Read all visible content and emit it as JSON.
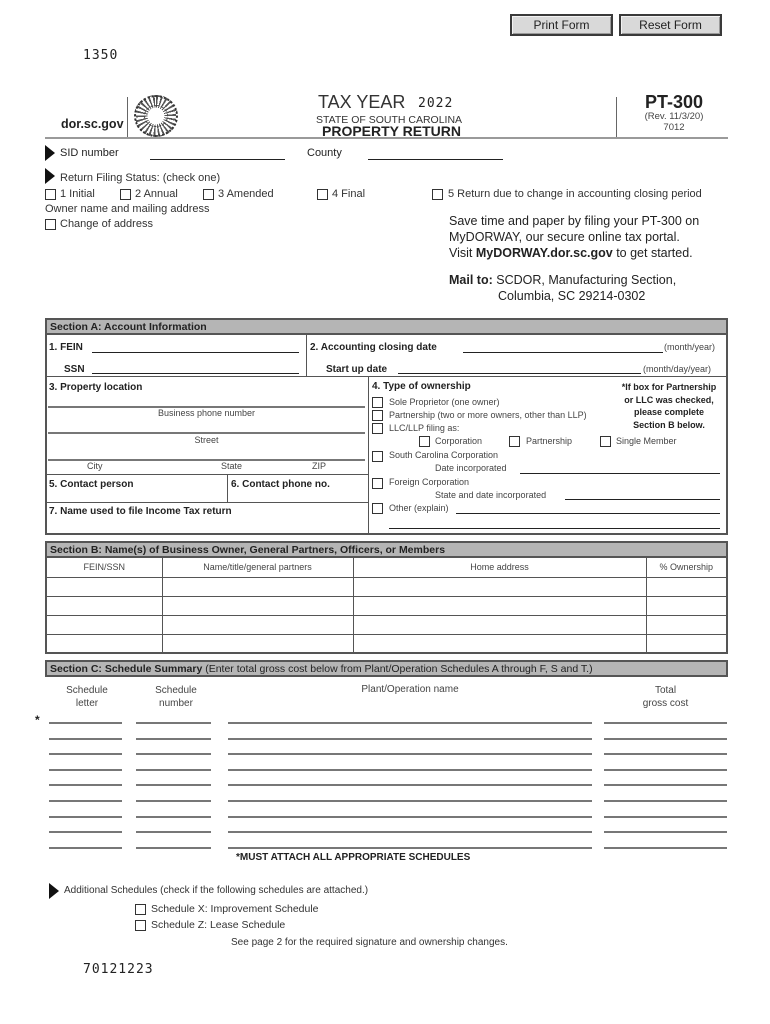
{
  "toolbar": {
    "print_label": "Print Form",
    "reset_label": "Reset Form"
  },
  "top_code": "1350",
  "bottom_code": "70121223",
  "header": {
    "website": "dor.sc.gov",
    "tax_year_label": "TAX YEAR",
    "tax_year": "2022",
    "state": "STATE OF SOUTH CAROLINA",
    "title": "PROPERTY RETURN",
    "form_number": "PT-300",
    "revision": "(Rev. 11/3/20)",
    "form_code": "7012"
  },
  "id_fields": {
    "sid_label": "SID number",
    "sid_value": "",
    "county_label": "County",
    "county_value": ""
  },
  "filing_status": {
    "label": "Return Filing Status: (check one)",
    "options": [
      {
        "label": "1 Initial",
        "checked": false
      },
      {
        "label": "2 Annual",
        "checked": false
      },
      {
        "label": "3 Amended",
        "checked": false
      },
      {
        "label": "4 Final",
        "checked": false
      },
      {
        "label": "5 Return due to change in accounting closing period",
        "checked": false
      }
    ],
    "owner_label": "Owner name and mailing address",
    "change_address": {
      "label": "Change of address",
      "checked": false
    }
  },
  "promo": {
    "line1": "Save time and paper by filing your PT-300 on",
    "line2": "MyDORWAY, our secure online tax portal.",
    "line3_pre": "Visit ",
    "line3_bold": "MyDORWAY.dor.sc.gov",
    "line3_post": " to get started.",
    "mail_label": "Mail to:",
    "mail_line1": "SCDOR, Manufacturing Section,",
    "mail_line2": "Columbia, SC  29214-0302"
  },
  "section_a": {
    "title": "Section A: Account Information",
    "fein_label": "1.  FEIN",
    "ssn_label": "SSN",
    "closing_label": "2. Accounting closing date",
    "closing_hint": "(month/year)",
    "startup_label": "Start up date",
    "startup_hint": "(month/day/year)",
    "property_label": "3.  Property location",
    "business_phone": "Business phone number",
    "street": "Street",
    "city": "City",
    "state": "State",
    "zip": "ZIP",
    "contact_person": "5. Contact person",
    "contact_phone": "6. Contact phone no.",
    "income_tax_name": "7.  Name used to file Income Tax return",
    "ownership": {
      "title": "4.  Type of ownership",
      "note": [
        "*If box for Partnership",
        "or LLC was checked,",
        "please complete",
        "Section B below."
      ],
      "sole": "Sole Proprietor (one owner)",
      "partnership": "Partnership (two or more owners, other than LLP)",
      "llc": "LLC/LLP filing as:",
      "llc_options": [
        "Corporation",
        "Partnership",
        "Single Member"
      ],
      "sc_corp": "South Carolina Corporation",
      "date_incorporated": "Date incorporated",
      "foreign_corp": "Foreign Corporation",
      "state_date_incorporated": "State and date incorporated",
      "other": "Other (explain)"
    }
  },
  "section_b": {
    "title": "Section B: Name(s) of Business Owner, General Partners, Officers, or Members",
    "columns": [
      "FEIN/SSN",
      "Name/title/general partners",
      "Home address",
      "% Ownership"
    ],
    "rows": [
      [
        "",
        "",
        "",
        ""
      ],
      [
        "",
        "",
        "",
        ""
      ],
      [
        "",
        "",
        "",
        ""
      ],
      [
        "",
        "",
        "",
        ""
      ]
    ]
  },
  "section_c": {
    "title_bold": "Section C: Schedule Summary",
    "title_rest": " (Enter total gross cost below from Plant/Operation Schedules A through F, S and T.)",
    "col_letter": [
      "Schedule",
      "letter"
    ],
    "col_number": [
      "Schedule",
      "number"
    ],
    "col_name": "Plant/Operation name",
    "col_cost": [
      "Total",
      "gross cost"
    ],
    "asterisk": "*",
    "row_count": 9,
    "must_attach": "*MUST ATTACH ALL APPROPRIATE SCHEDULES"
  },
  "additional": {
    "label": "Additional Schedules (check if the following schedules are attached.)",
    "schedule_x": "Schedule X: Improvement Schedule",
    "schedule_z": "Schedule Z: Lease Schedule",
    "see_page": "See page 2 for the required signature and ownership changes."
  }
}
